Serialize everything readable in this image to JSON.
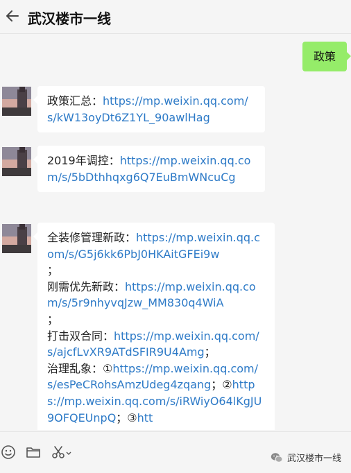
{
  "header": {
    "title": "武汉楼市一线"
  },
  "messages": {
    "m1": {
      "text": "政策"
    },
    "m2": {
      "label": "政策汇总：",
      "url": "https://mp.weixin.qq.com/s/kW13oyDt6Z1YL_90awlHag"
    },
    "m3": {
      "label": "2019年调控：",
      "url": "https://mp.weixin.qq.com/s/5bDthhqxg6Q7EuBmWNcuCg"
    },
    "m4": {
      "label1": "全装修管理新政：",
      "url1": "https://mp.weixin.qq.com/s/G5j6kk6PbJ0HKAitGFEi9w",
      "sep1": "；",
      "label2": "刚需优先新政：",
      "url2": "https://mp.weixin.qq.com/s/5r9nhyvqJzw_MM830q4WiA",
      "sep2": "；",
      "label3": "打击双合同：",
      "url3": "https://mp.weixin.qq.com/s/ajcfLvXR9ATdSFIR9U4Amg",
      "sep3": "；",
      "label4": "治理乱象：①",
      "url4": "https://mp.weixin.qq.com/s/esPeCRohsAmzUdeg4zqang",
      "sep4": "；②",
      "url5": "https://mp.weixin.qq.com/s/iRWiyO64lKgJU9OFQEUnpQ",
      "sep5": "；③",
      "url6": "htt"
    }
  },
  "toolbar": {
    "icons": [
      "emoji-icon",
      "folder-icon",
      "scissors-icon",
      "chevron-down-icon"
    ]
  },
  "watermark": {
    "text": "武汉楼市一线",
    "icon": "wechat-icon"
  },
  "colors": {
    "link": "#2d7ac7",
    "sent_bubble": "#95ec69",
    "received_bubble": "#ffffff",
    "background": "#f5f5f5"
  }
}
